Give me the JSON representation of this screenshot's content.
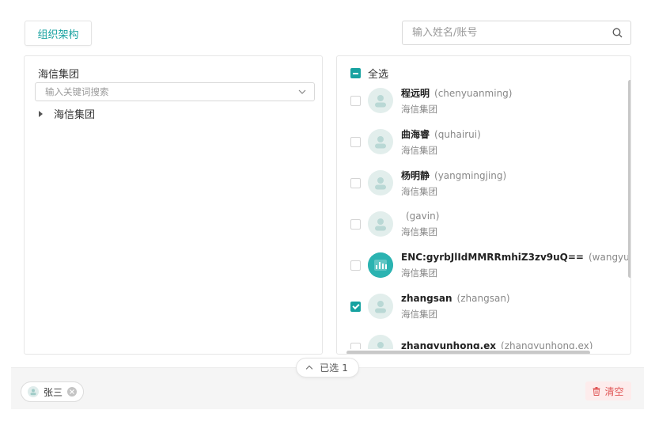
{
  "header": {
    "tab_label": "组织架构",
    "search_placeholder": "输入姓名/账号"
  },
  "left_panel": {
    "org_title": "海信集团",
    "keyword_placeholder": "输入关键词搜索",
    "tree_root": "海信集团"
  },
  "right_panel": {
    "select_all_label": "全选",
    "users": [
      {
        "name": "程远明",
        "account": "(chenyuanming)",
        "dept": "海信集团",
        "checked": false
      },
      {
        "name": "曲海睿",
        "account": "(quhairui)",
        "dept": "海信集团",
        "checked": false
      },
      {
        "name": "杨明静",
        "account": "(yangmingjing)",
        "dept": "海信集团",
        "checked": false
      },
      {
        "name": "",
        "account": "(gavin)",
        "dept": "海信集团",
        "checked": false
      },
      {
        "name": "ENC:gyrbJlIdMMRRmhiZ3zv9uQ==",
        "account": "(wangyuans",
        "dept": "海信集团",
        "checked": false
      },
      {
        "name": "zhangsan",
        "account": "(zhangsan)",
        "dept": "海信集团",
        "checked": true
      },
      {
        "name": "zhangyunhong.ex",
        "account": "(zhangyunhong.ex)",
        "dept": "",
        "checked": false
      }
    ]
  },
  "footer": {
    "selected_label": "已选",
    "selected_count": "1",
    "chips": [
      {
        "name": "张三"
      }
    ],
    "clear_label": "清空"
  },
  "colors": {
    "accent": "#17a2a0",
    "danger": "#e05656"
  }
}
